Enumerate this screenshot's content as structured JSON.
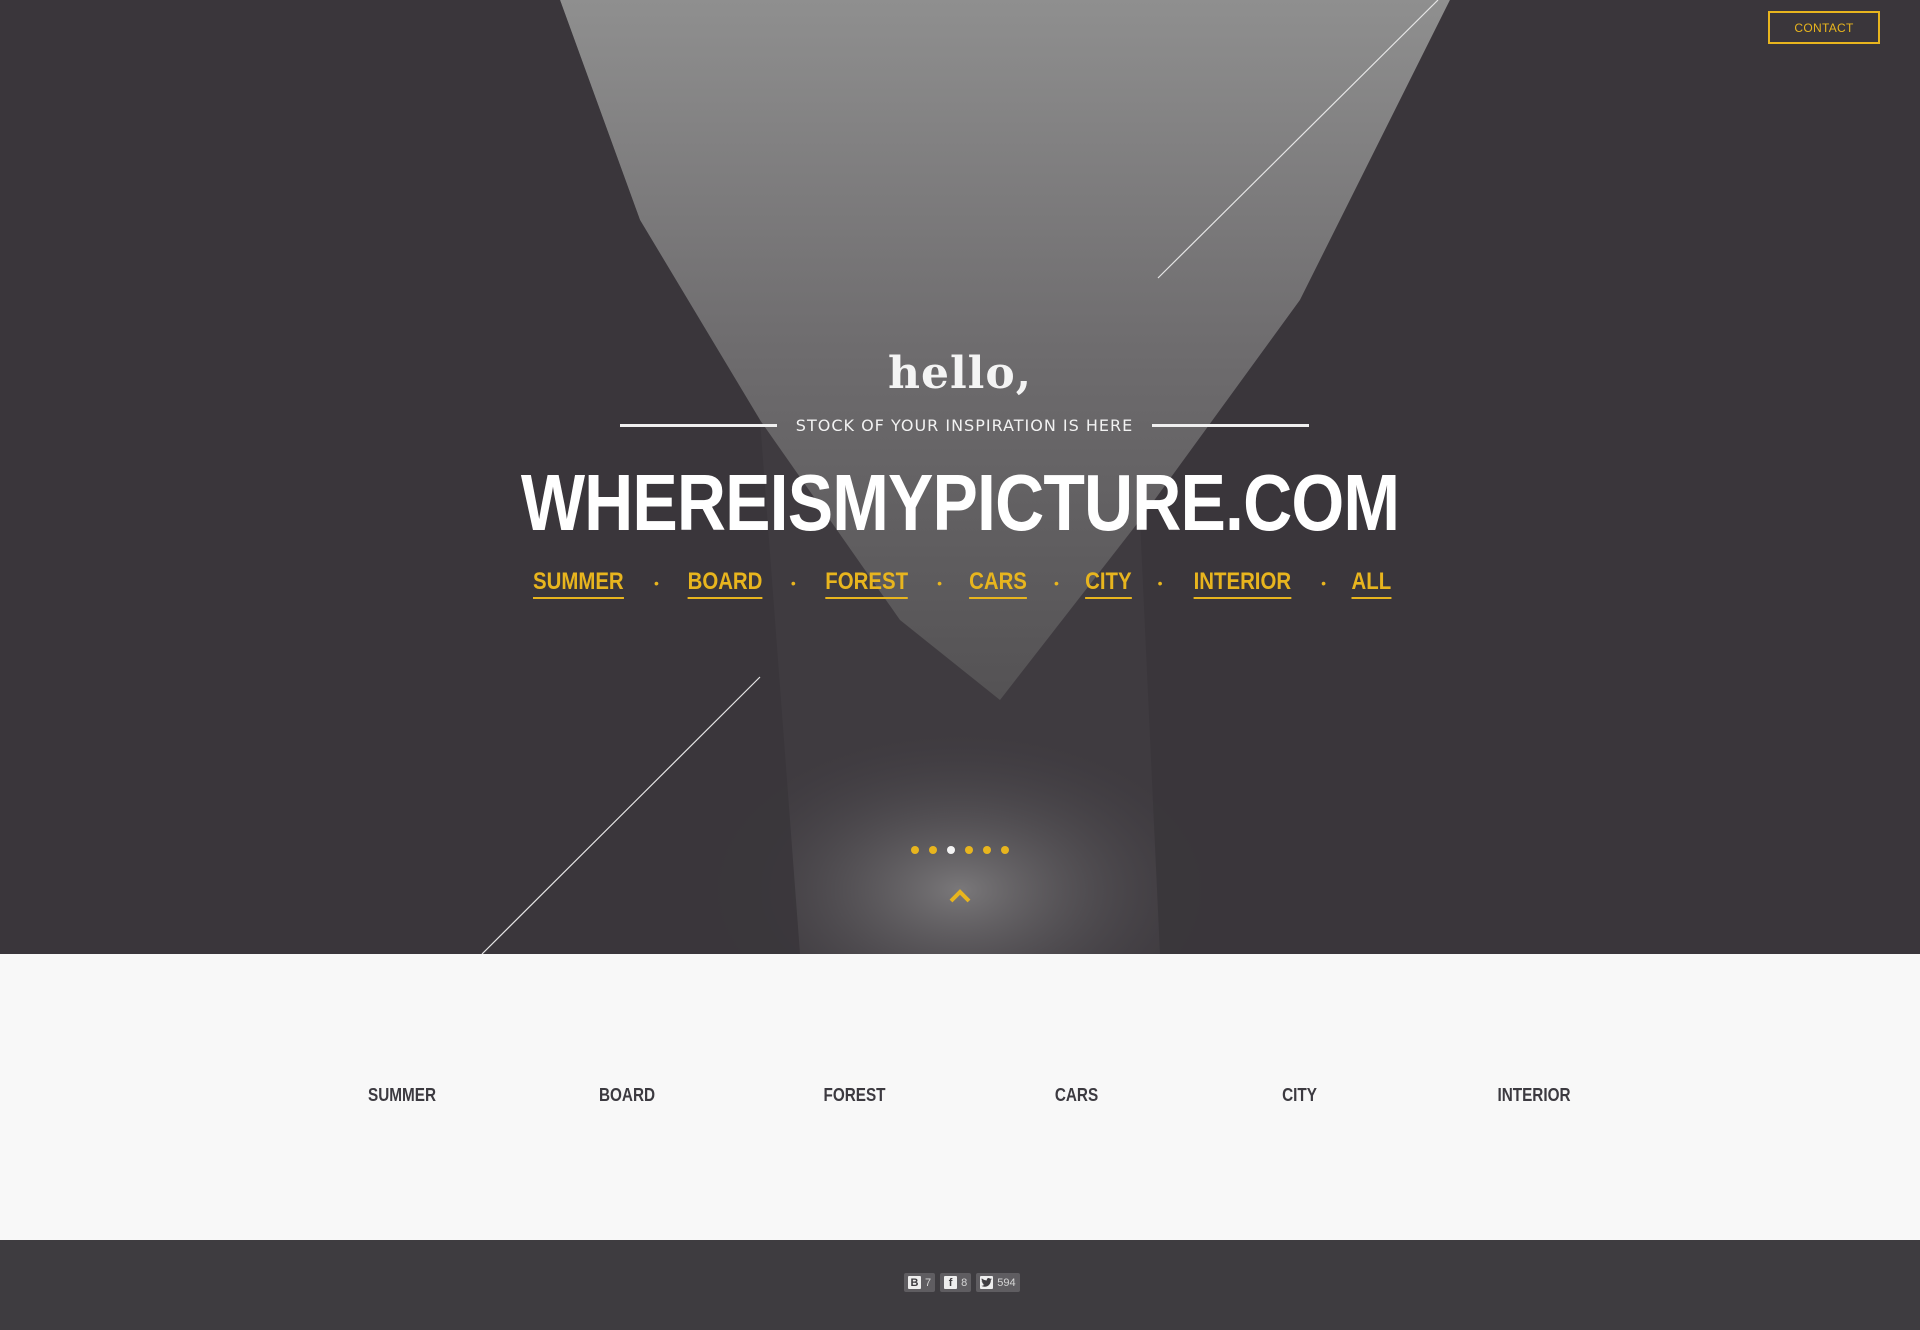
{
  "header": {
    "contact_label": "CONTACT"
  },
  "hero": {
    "hello": "hello,",
    "tagline": "STOCK OF YOUR INSPIRATION IS HERE",
    "site_title": "WHEREISMYPICTURE.COM",
    "nav": [
      "SUMMER",
      "BOARD",
      "FOREST",
      "CARS",
      "CITY",
      "INTERIOR",
      "ALL"
    ],
    "slide_count": 6,
    "active_slide": 3,
    "scroll_icon": "chevron-up-icon"
  },
  "categories": [
    "SUMMER",
    "BOARD",
    "FOREST",
    "CARS",
    "CITY",
    "INTERIOR"
  ],
  "footer": {
    "social": [
      {
        "icon": "vk-icon",
        "glyph": "B",
        "count": "7"
      },
      {
        "icon": "facebook-icon",
        "glyph": "f",
        "count": "8"
      },
      {
        "icon": "twitter-icon",
        "glyph": "t",
        "count": "594"
      }
    ]
  },
  "colors": {
    "accent": "#e8b51e",
    "hero_bg": "#3e3a3f",
    "footer_bg": "#3e3c40",
    "page_bg": "#f8f8f8"
  }
}
